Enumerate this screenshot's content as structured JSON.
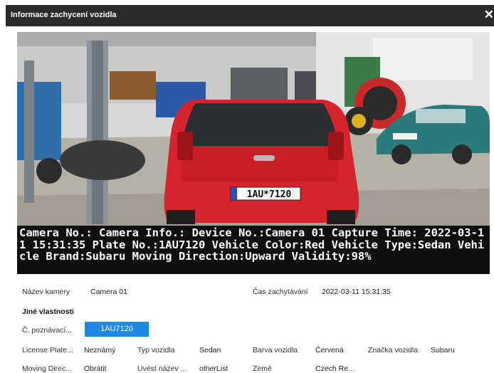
{
  "dialog": {
    "title": "Informace zachycení vozidla",
    "close_glyph": "✕"
  },
  "capture": {
    "plate_on_car": "1AU*7120",
    "overlay_text": "Camera No.: Camera Info.: Device No.:Camera 01 Capture Time: 2022-03-11 15:31:35 Plate No.:1AU7120 Vehicle Color:Red Vehicle Type:Sedan Vehicle Brand:Subaru Moving Direction:Upward Validity:98%"
  },
  "info": {
    "camera_label": "Název kamery",
    "camera_value": "Camera 01",
    "time_label": "Čas zachytávání",
    "time_value": "2022-03-11 15:31:35",
    "section_title": "Jiné vlastnosti",
    "plate_label": "Č. poznávací...",
    "plate_value": "1AU7120",
    "license_label": "License Plate...",
    "license_value": "Neznámý",
    "vtype_label": "Typ vozidla",
    "vtype_value": "Sedan",
    "color_label": "Barva vozidla",
    "color_value": "Červená",
    "brand_label": "Značka vozidla",
    "brand_value": "Subaru",
    "direction_label": "Moving Direc...",
    "direction_value": "Obrátit",
    "listname_label": "Uvést název ...",
    "listname_value": "otherList",
    "country_label": "Země",
    "country_value": "Czech Re..."
  },
  "colors": {
    "titlebar": "#2b2b2b",
    "accent": "#1e88e5",
    "car": "#d6242c"
  }
}
